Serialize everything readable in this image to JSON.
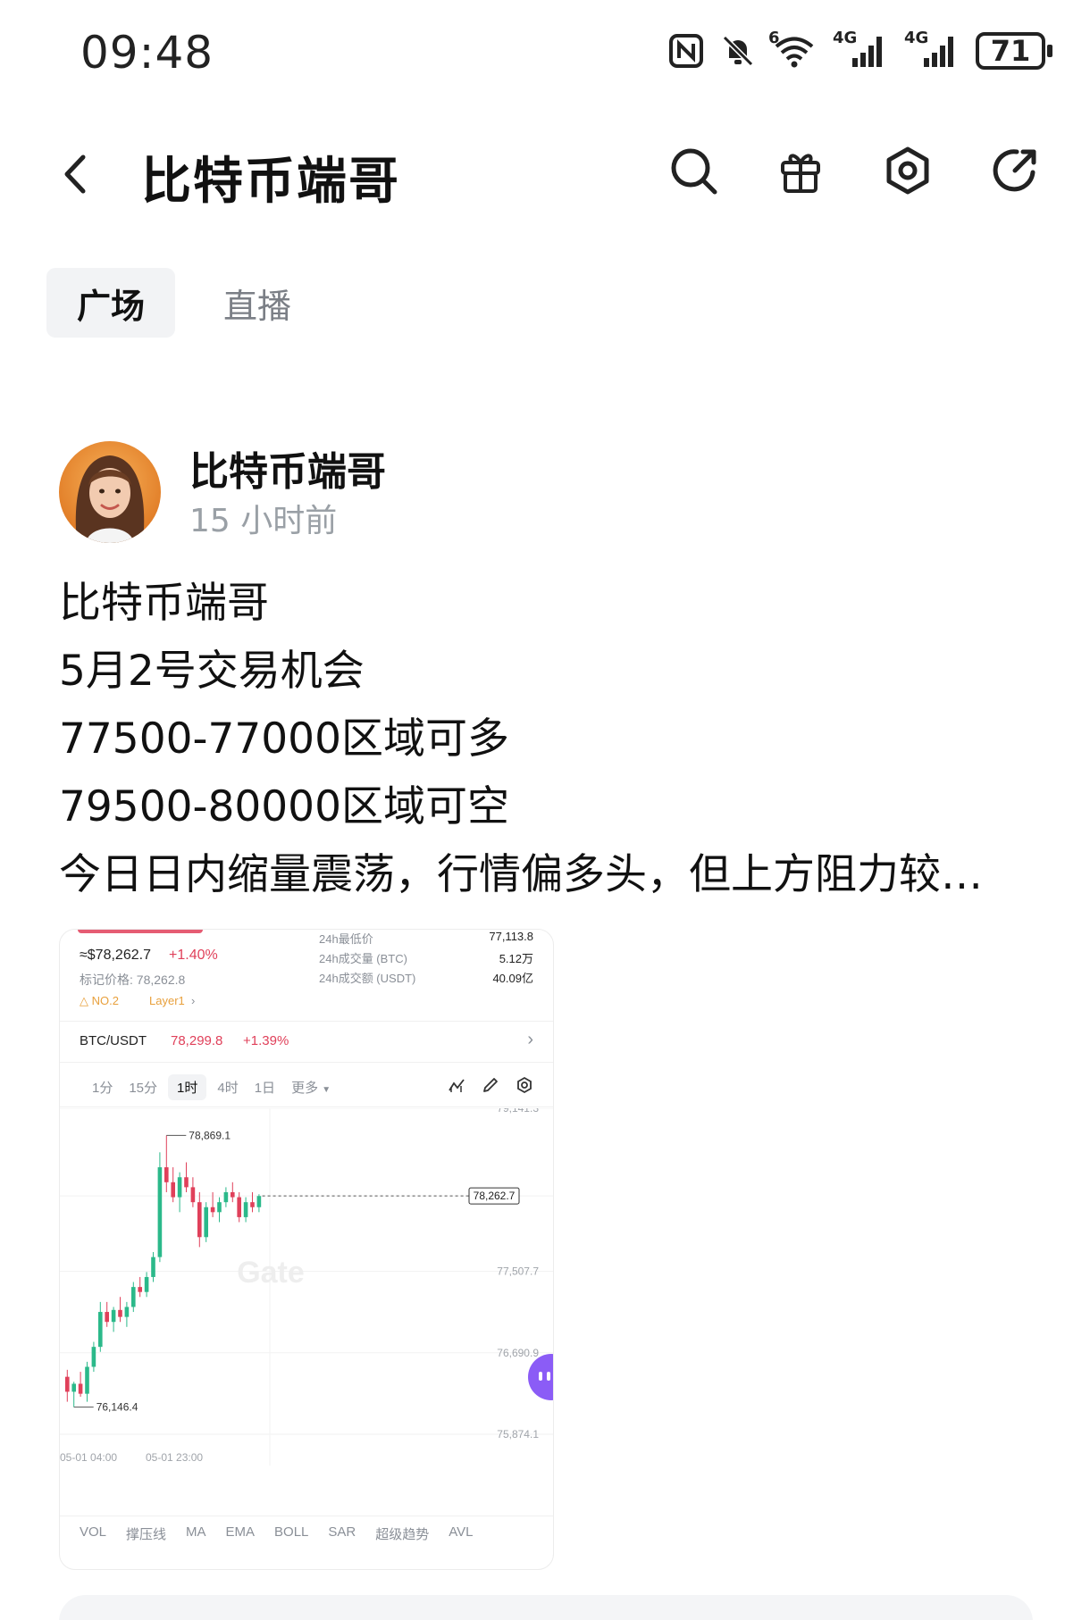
{
  "status_bar": {
    "time": "09:48",
    "wifi_badge": "6",
    "signal_1": "4G",
    "signal_2": "4G",
    "battery": "71",
    "icons": [
      "nfc-icon",
      "mute-bell-icon",
      "wifi-icon",
      "signal-icon",
      "signal-icon",
      "battery-icon"
    ]
  },
  "header": {
    "title": "比特币端哥",
    "actions": [
      "search-icon",
      "gift-icon",
      "settings-hex-icon",
      "share-refresh-icon"
    ]
  },
  "tabs": [
    {
      "label": "广场",
      "active": true
    },
    {
      "label": "直播",
      "active": false
    }
  ],
  "post": {
    "author": "比特币端哥",
    "time": "15 小时前",
    "lines": [
      "比特币端哥",
      "5月2号交易机会",
      "77500-77000区域可多",
      "79500-80000区域可空",
      "今日日内缩量震荡，行情偏多头，但上方阻力较…"
    ]
  },
  "attached_screenshot": {
    "approx_price": "≈$78,262.7",
    "change_pct": "+1.40%",
    "mark_price": "标记价格: 78,262.8",
    "rank_badge": "NO.2",
    "category": "Layer1",
    "stats": [
      {
        "label": "24h最低价",
        "value": "77,113.8"
      },
      {
        "label": "24h成交量 (BTC)",
        "value": "5.12万"
      },
      {
        "label": "24h成交额 (USDT)",
        "value": "40.09亿"
      }
    ],
    "pair": {
      "name": "BTC/USDT",
      "price": "78,299.8",
      "change": "+1.39%"
    },
    "timeframes": [
      "1分",
      "15分",
      "1时",
      "4时",
      "1日",
      "更多"
    ],
    "active_timeframe": "1时",
    "y_axis": [
      "79,141.3",
      "78,262.7",
      "77,507.7",
      "76,690.9",
      "75,874.1"
    ],
    "high_label": "78,869.1",
    "low_label": "76,146.4",
    "x_axis": [
      "05-01 04:00",
      "05-01 23:00"
    ],
    "watermark": "Gate",
    "indicators": [
      "VOL",
      "撑压线",
      "MA",
      "EMA",
      "BOLL",
      "SAR",
      "超级趋势",
      "AVL"
    ],
    "colors": {
      "up": "#2bb98a",
      "down": "#e0405a"
    },
    "candles": [
      {
        "o": 76450,
        "h": 76520,
        "l": 76200,
        "c": 76300
      },
      {
        "o": 76300,
        "h": 76400,
        "l": 76146,
        "c": 76380
      },
      {
        "o": 76380,
        "h": 76500,
        "l": 76250,
        "c": 76280
      },
      {
        "o": 76280,
        "h": 76600,
        "l": 76200,
        "c": 76550
      },
      {
        "o": 76550,
        "h": 76800,
        "l": 76500,
        "c": 76750
      },
      {
        "o": 76750,
        "h": 77200,
        "l": 76700,
        "c": 77100
      },
      {
        "o": 77100,
        "h": 77200,
        "l": 76950,
        "c": 77000
      },
      {
        "o": 77000,
        "h": 77150,
        "l": 76900,
        "c": 77120
      },
      {
        "o": 77120,
        "h": 77250,
        "l": 77000,
        "c": 77050
      },
      {
        "o": 77050,
        "h": 77200,
        "l": 76950,
        "c": 77150
      },
      {
        "o": 77150,
        "h": 77400,
        "l": 77100,
        "c": 77350
      },
      {
        "o": 77350,
        "h": 77450,
        "l": 77250,
        "c": 77300
      },
      {
        "o": 77300,
        "h": 77500,
        "l": 77250,
        "c": 77450
      },
      {
        "o": 77450,
        "h": 77700,
        "l": 77400,
        "c": 77650
      },
      {
        "o": 77650,
        "h": 78700,
        "l": 77600,
        "c": 78550
      },
      {
        "o": 78550,
        "h": 78869,
        "l": 78300,
        "c": 78400
      },
      {
        "o": 78400,
        "h": 78550,
        "l": 78200,
        "c": 78250
      },
      {
        "o": 78250,
        "h": 78500,
        "l": 78100,
        "c": 78450
      },
      {
        "o": 78450,
        "h": 78600,
        "l": 78300,
        "c": 78350
      },
      {
        "o": 78350,
        "h": 78450,
        "l": 78150,
        "c": 78200
      },
      {
        "o": 78200,
        "h": 78300,
        "l": 77750,
        "c": 77850
      },
      {
        "o": 77850,
        "h": 78200,
        "l": 77800,
        "c": 78150
      },
      {
        "o": 78150,
        "h": 78300,
        "l": 78050,
        "c": 78100
      },
      {
        "o": 78100,
        "h": 78250,
        "l": 78000,
        "c": 78200
      },
      {
        "o": 78200,
        "h": 78350,
        "l": 78150,
        "c": 78300
      },
      {
        "o": 78300,
        "h": 78400,
        "l": 78200,
        "c": 78250
      },
      {
        "o": 78250,
        "h": 78300,
        "l": 78000,
        "c": 78050
      },
      {
        "o": 78050,
        "h": 78250,
        "l": 78000,
        "c": 78200
      },
      {
        "o": 78200,
        "h": 78300,
        "l": 78100,
        "c": 78150
      },
      {
        "o": 78150,
        "h": 78280,
        "l": 78100,
        "c": 78262
      }
    ]
  }
}
